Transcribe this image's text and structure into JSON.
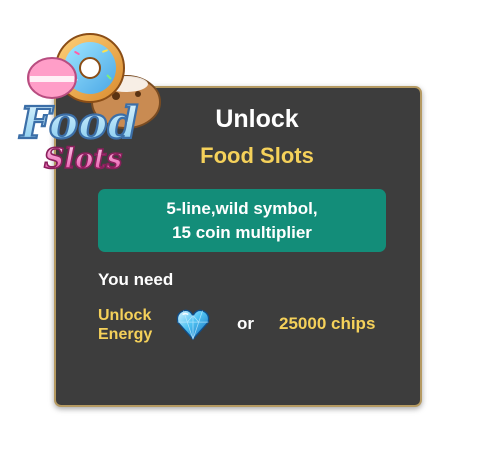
{
  "dialog": {
    "title_line1": "Unlock",
    "title_line2": "Food Slots",
    "feature_line1": "5-line,wild symbol,",
    "feature_line2": "15 coin multiplier",
    "you_need": "You need",
    "energy_line1": "Unlock",
    "energy_line2": "Energy",
    "or_text": "or",
    "chips_text": "25000 chips"
  },
  "logo": {
    "word1": "Food",
    "word2": "Slots"
  },
  "icons": {
    "energy": "blue-heart-gem-icon",
    "logo": "donut-food-logo"
  },
  "colors": {
    "panel_bg": "#3d3d3d",
    "panel_border": "#b59a62",
    "accent_yellow": "#f5d15a",
    "feature_bg": "#138d79",
    "text_white": "#ffffff"
  }
}
